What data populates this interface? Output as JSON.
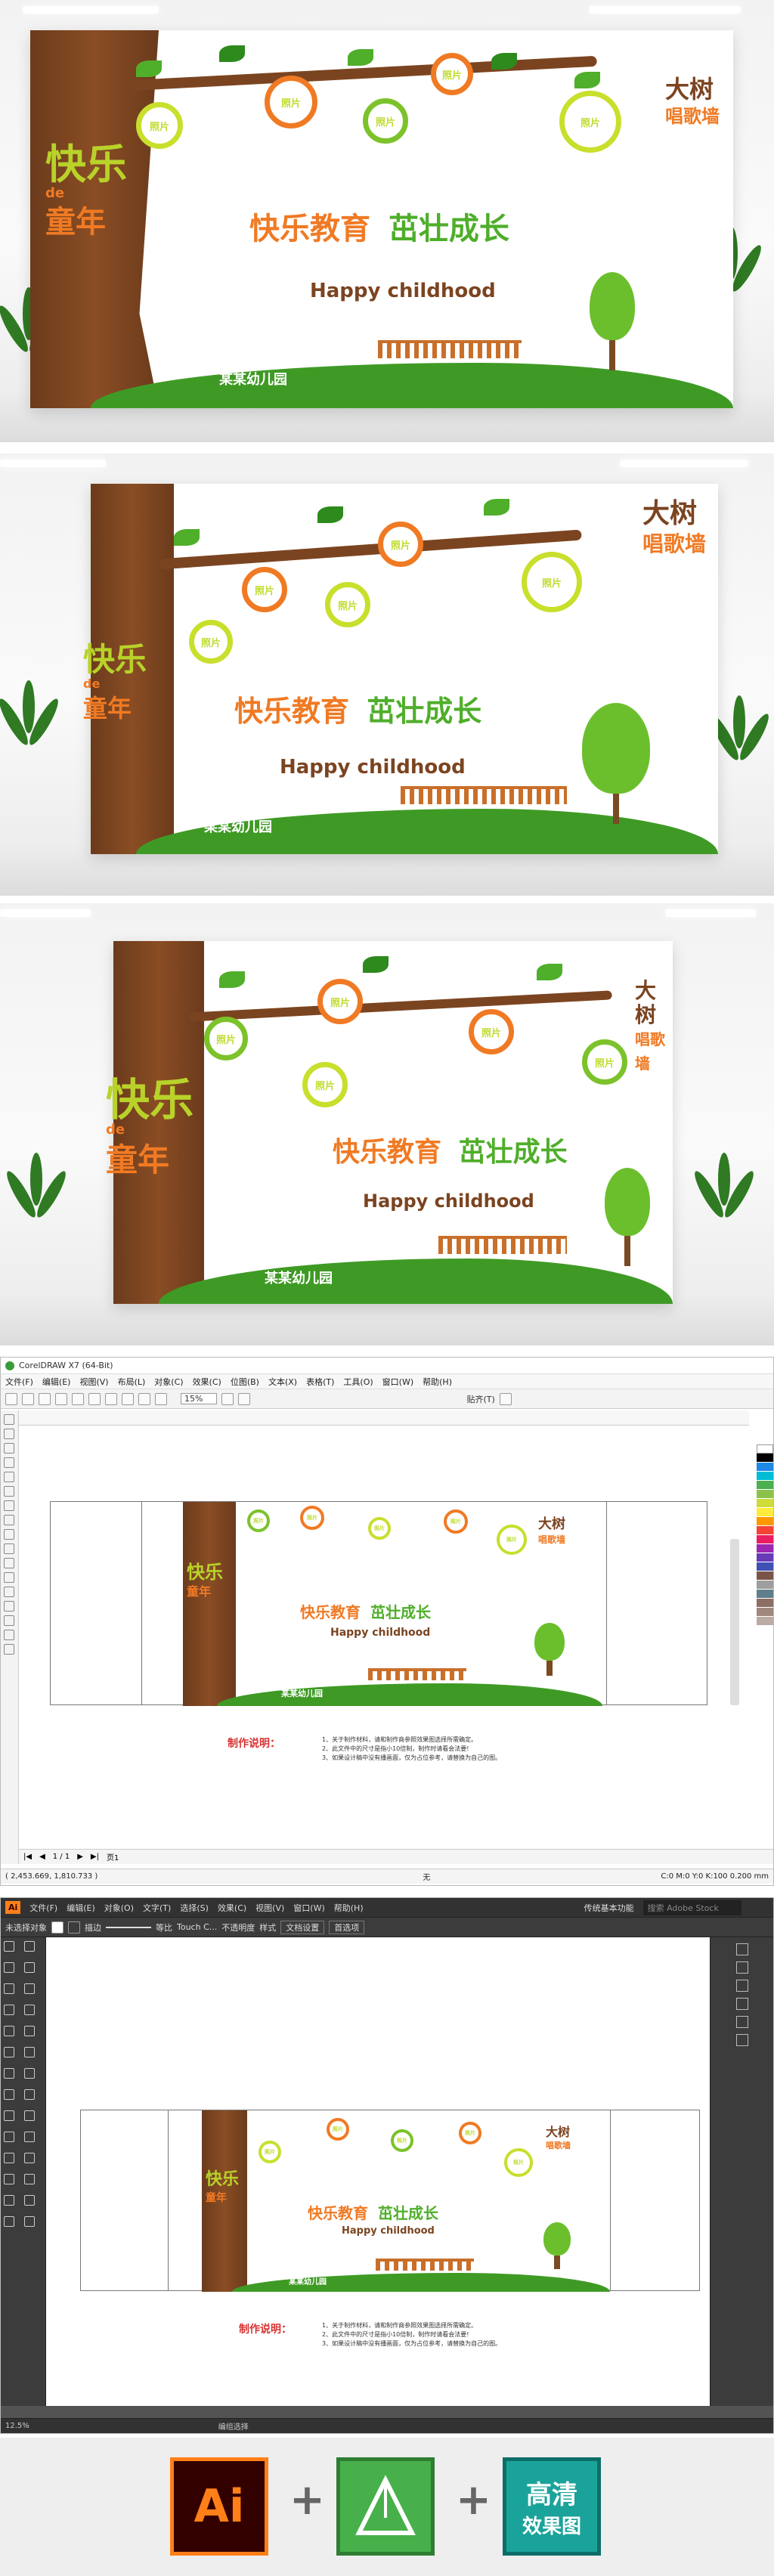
{
  "scene": {
    "title_left_1": "快乐",
    "title_left_de": "de",
    "title_left_2": "童年",
    "slogan_1": "快乐教育",
    "slogan_2": "茁壮成长",
    "subtitle": "Happy childhood",
    "school": "某某幼儿园",
    "right_title_1": "大树",
    "right_title_2": "唱歌墙",
    "bubble_text": "照片"
  },
  "corel": {
    "window_title": "CorelDRAW X7 (64-Bit)",
    "menu": [
      "文件(F)",
      "编辑(E)",
      "视图(V)",
      "布局(L)",
      "对象(C)",
      "效果(C)",
      "位图(B)",
      "文本(X)",
      "表格(T)",
      "工具(O)",
      "窗口(W)",
      "帮助(H)"
    ],
    "zoom": "15%",
    "snap_label": "贴齐(T)",
    "page_indicator": "1 / 1",
    "page_tab": "页1",
    "coords": "( 2,453.669, 1,810.733 )",
    "fill_none": "无",
    "color_info": "C:0 M:0 Y:0 K:100  0.200 mm",
    "notes_title": "制作说明：",
    "notes": [
      "1、关于制作材料，请和制作商参照效果图选择所需确定。",
      "2、此文件中的尺寸是指小10倍制，制作时请看会法要!",
      "3、如果设计稿中没有播画面，仅为占位参考，请替换为自己的图。"
    ]
  },
  "illustrator": {
    "app_badge": "Ai",
    "menu": [
      "文件(F)",
      "编辑(E)",
      "对象(O)",
      "文字(T)",
      "选择(S)",
      "效果(C)",
      "视图(V)",
      "窗口(W)",
      "帮助(H)"
    ],
    "workspace": "传统基本功能",
    "search_placeholder": "搜索 Adobe Stock",
    "no_selection": "未选择对象",
    "stroke_label": "描边",
    "uniform": "等比",
    "touch": "Touch C...",
    "opacity": "不透明度",
    "style": "样式",
    "doc_setup": "文档设置",
    "prefs": "首选项",
    "zoom": "12.5%",
    "status_tool": "编组选择",
    "notes_title": "制作说明："
  },
  "badges": {
    "ai": "Ai",
    "hd_1": "高清",
    "hd_2": "效果图",
    "plus": "+"
  },
  "colors": {
    "brown": "#7b4420",
    "orange": "#f07a24",
    "green": "#4fae2a",
    "lime": "#c8df2c",
    "ai_orange": "#ff7f18",
    "ai_bg": "#330000",
    "hd_teal": "#1aa39a"
  }
}
